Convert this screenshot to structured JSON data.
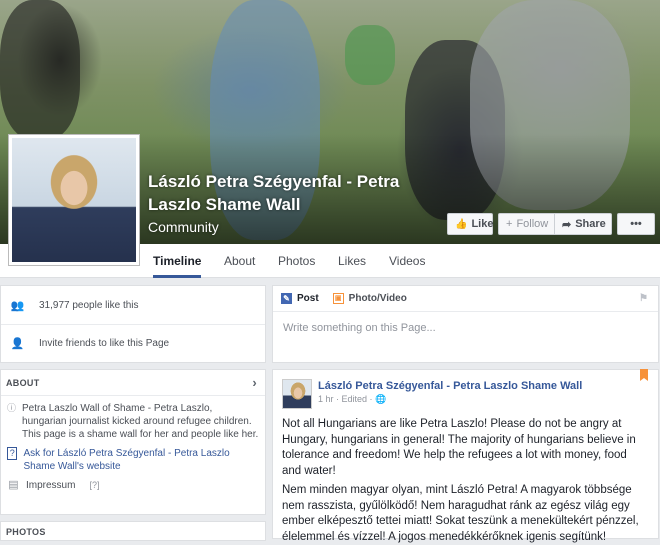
{
  "page": {
    "title": "László Petra Szégyenfal - Petra Laszlo Shame Wall",
    "category": "Community"
  },
  "cover_actions": {
    "like": "Like",
    "follow": "Follow",
    "share": "Share",
    "more": "•••"
  },
  "tabs": [
    "Timeline",
    "About",
    "Photos",
    "Likes",
    "Videos"
  ],
  "left": {
    "likes_count": "31,977 people like this",
    "invite": "Invite friends to like this Page",
    "about_heading": "ABOUT",
    "about_description": "Petra Laszlo Wall of Shame - Petra Laszlo, hungarian journalist kicked around refugee children. This page is a shame wall for her and people like her.",
    "website_link": "Ask for László Petra Szégyenfal - Petra Laszlo Shame Wall's website",
    "impressum": "Impressum",
    "impressum_help": "[?]",
    "photos_heading": "PHOTOS"
  },
  "composer": {
    "post_tab": "Post",
    "photo_tab": "Photo/Video",
    "placeholder": "Write something on this Page..."
  },
  "story": {
    "author": "László Petra Szégyenfal - Petra Laszlo Shame Wall",
    "meta": "1 hr · Edited · ",
    "paragraph1": "Not all Hungarians are like Petra Laszlo! Please do not be angry at Hungary, hungarians in general! The majority of hungarians believe in tolerance and freedom! We help the refugees a lot with money, food and water!",
    "paragraph2": "Nem minden magyar olyan, mint László Petra! A magyarok többsége nem rasszista, gyűlölködő! Nem haragudhat ránk az egész világ egy ember elképesztő tettei miatt! Sokat teszünk a menekültekért pénzzel, élelemmel és vízzel! A jogos menedékkérőknek igenis segítünk!"
  },
  "colors": {
    "link": "#365899",
    "background": "#e9ebee",
    "bookmark": "#f7923a"
  }
}
